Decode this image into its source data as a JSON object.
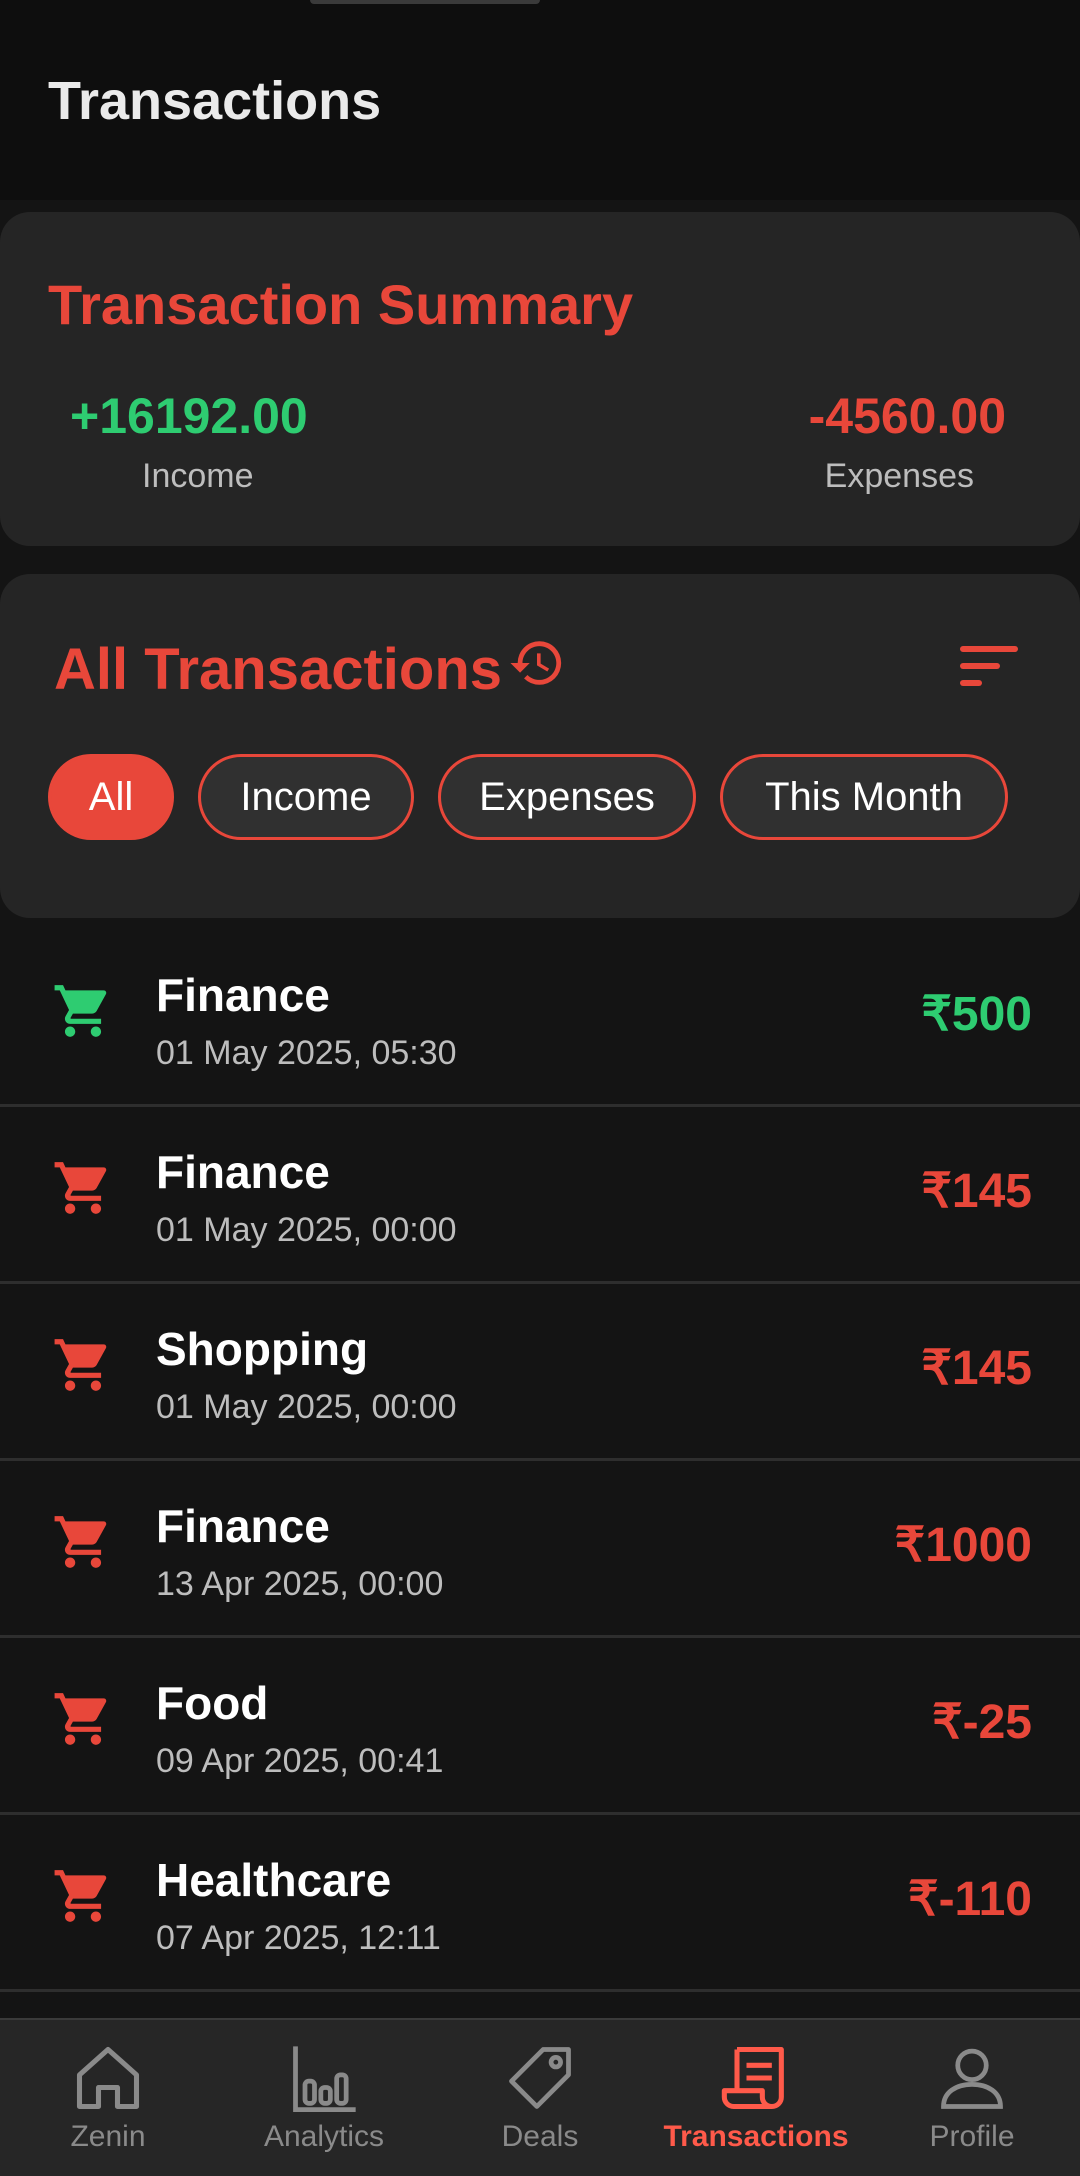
{
  "header": {
    "title": "Transactions"
  },
  "summary": {
    "title": "Transaction Summary",
    "income_value": "+16192.00",
    "income_label": "Income",
    "expense_value": "-4560.00",
    "expense_label": "Expenses"
  },
  "all_transactions": {
    "title": "All Transactions",
    "icons": {
      "history": "history-icon",
      "sort": "sort-icon"
    },
    "filters": [
      {
        "label": "All",
        "selected": true
      },
      {
        "label": "Income",
        "selected": false
      },
      {
        "label": "Expenses",
        "selected": false
      },
      {
        "label": "This Month",
        "selected": false
      }
    ]
  },
  "transactions": [
    {
      "category": "Finance",
      "date": "01 May 2025, 05:30",
      "amount": "₹500",
      "type": "income"
    },
    {
      "category": "Finance",
      "date": "01 May 2025, 00:00",
      "amount": "₹145",
      "type": "expense"
    },
    {
      "category": "Shopping",
      "date": "01 May 2025, 00:00",
      "amount": "₹145",
      "type": "expense"
    },
    {
      "category": "Finance",
      "date": "13 Apr 2025, 00:00",
      "amount": "₹1000",
      "type": "expense"
    },
    {
      "category": "Food",
      "date": "09 Apr 2025, 00:41",
      "amount": "₹-25",
      "type": "expense"
    },
    {
      "category": "Healthcare",
      "date": "07 Apr 2025, 12:11",
      "amount": "₹-110",
      "type": "expense"
    }
  ],
  "nav": {
    "items": [
      {
        "label": "Zenin",
        "icon": "home-icon",
        "active": false
      },
      {
        "label": "Analytics",
        "icon": "bar-chart-icon",
        "active": false
      },
      {
        "label": "Deals",
        "icon": "tag-icon",
        "active": false
      },
      {
        "label": "Transactions",
        "icon": "receipt-icon",
        "active": true
      },
      {
        "label": "Profile",
        "icon": "person-icon",
        "active": false
      }
    ]
  },
  "colors": {
    "accent": "#e8473a",
    "income": "#2ecc71",
    "background": "#141414",
    "card": "#252525"
  }
}
